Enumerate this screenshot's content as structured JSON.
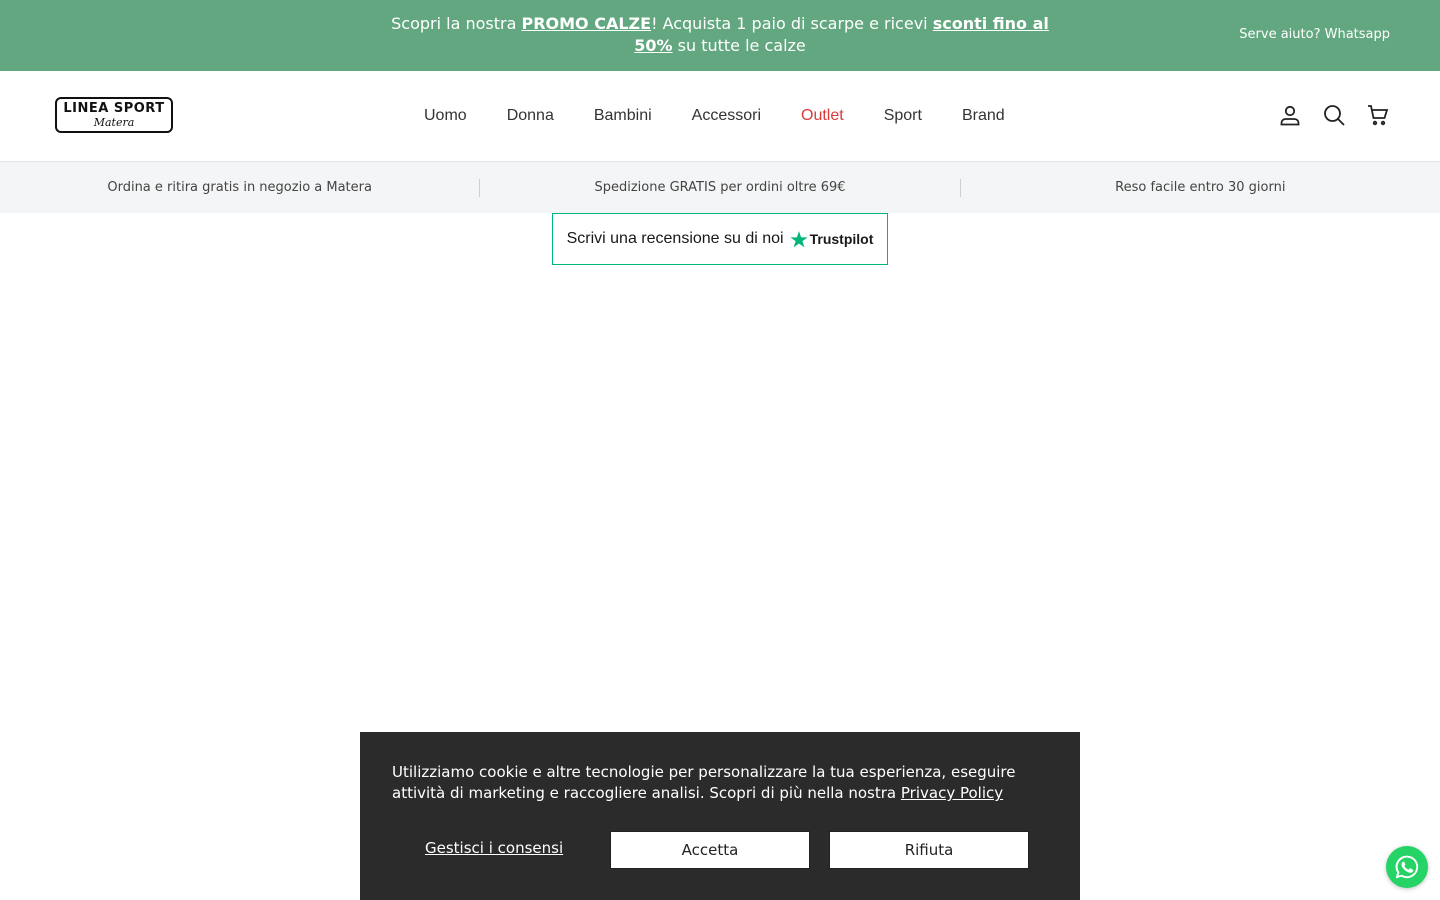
{
  "announcement": {
    "prefix": "Scopri la nostra ",
    "promo_link": "PROMO CALZE",
    "middle": "! Acquista 1 paio di scarpe e ricevi ",
    "discount_link": "sconti fino al 50%",
    "suffix": " su tutte le calze",
    "help": "Serve aiuto? Whatsapp"
  },
  "logo": {
    "main": "LINEA SPORT",
    "sub": "Matera"
  },
  "nav": {
    "items": [
      "Uomo",
      "Donna",
      "Bambini",
      "Accessori",
      "Outlet",
      "Sport",
      "Brand"
    ],
    "highlight_color": "#d93b3b"
  },
  "header_icons": [
    "account-icon",
    "search-icon",
    "cart-icon"
  ],
  "usp": [
    "Ordina e ritira gratis in negozio a Matera",
    "Spedizione GRATIS per ordini oltre 69€",
    "Reso facile entro 30 giorni"
  ],
  "trustpilot": {
    "text": "Scrivi una recensione su di noi",
    "brand": "Trustpilot",
    "color": "#00b67a"
  },
  "cookie": {
    "text": "Utilizziamo cookie e altre tecnologie per personalizzare la tua esperienza, eseguire attività di marketing e raccogliere analisi. Scopri di più nella nostra ",
    "policy_link": "Privacy Policy",
    "manage": "Gestisci i consensi",
    "accept": "Accetta",
    "reject": "Rifiuta"
  },
  "colors": {
    "announcement_bg": "#62a77f",
    "cookie_bg": "#2b2b2b",
    "whatsapp": "#25d366"
  }
}
